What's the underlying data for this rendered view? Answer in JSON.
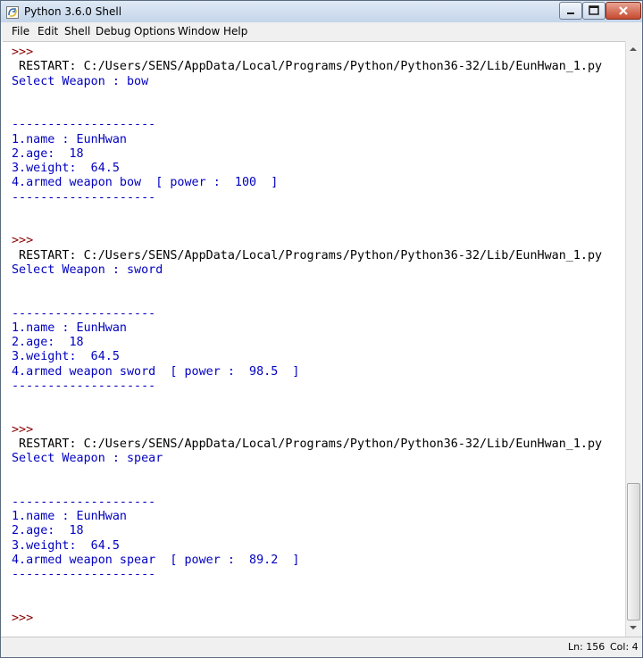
{
  "window": {
    "title": "Python 3.6.0 Shell"
  },
  "menu": [
    "File",
    "Edit",
    "Shell",
    "Debug",
    "Options",
    "Window",
    "Help"
  ],
  "shell_lines": [
    {
      "kind": "prompt",
      "text": ">>>"
    },
    {
      "kind": "restart",
      "text": " RESTART: C:/Users/SENS/AppData/Local/Programs/Python/Python36-32/Lib/EunHwan_1.py"
    },
    {
      "kind": "output",
      "text": "Select Weapon : bow"
    },
    {
      "kind": "output",
      "text": ""
    },
    {
      "kind": "output",
      "text": ""
    },
    {
      "kind": "output",
      "text": "--------------------"
    },
    {
      "kind": "output",
      "text": "1.name : EunHwan"
    },
    {
      "kind": "output",
      "text": "2.age:  18"
    },
    {
      "kind": "output",
      "text": "3.weight:  64.5"
    },
    {
      "kind": "output",
      "text": "4.armed weapon bow  [ power :  100  ]"
    },
    {
      "kind": "output",
      "text": "--------------------"
    },
    {
      "kind": "output",
      "text": ""
    },
    {
      "kind": "output",
      "text": ""
    },
    {
      "kind": "prompt",
      "text": ">>>"
    },
    {
      "kind": "restart",
      "text": " RESTART: C:/Users/SENS/AppData/Local/Programs/Python/Python36-32/Lib/EunHwan_1.py"
    },
    {
      "kind": "output",
      "text": "Select Weapon : sword"
    },
    {
      "kind": "output",
      "text": ""
    },
    {
      "kind": "output",
      "text": ""
    },
    {
      "kind": "output",
      "text": "--------------------"
    },
    {
      "kind": "output",
      "text": "1.name : EunHwan"
    },
    {
      "kind": "output",
      "text": "2.age:  18"
    },
    {
      "kind": "output",
      "text": "3.weight:  64.5"
    },
    {
      "kind": "output",
      "text": "4.armed weapon sword  [ power :  98.5  ]"
    },
    {
      "kind": "output",
      "text": "--------------------"
    },
    {
      "kind": "output",
      "text": ""
    },
    {
      "kind": "output",
      "text": ""
    },
    {
      "kind": "prompt",
      "text": ">>>"
    },
    {
      "kind": "restart",
      "text": " RESTART: C:/Users/SENS/AppData/Local/Programs/Python/Python36-32/Lib/EunHwan_1.py"
    },
    {
      "kind": "output",
      "text": "Select Weapon : spear"
    },
    {
      "kind": "output",
      "text": ""
    },
    {
      "kind": "output",
      "text": ""
    },
    {
      "kind": "output",
      "text": "--------------------"
    },
    {
      "kind": "output",
      "text": "1.name : EunHwan"
    },
    {
      "kind": "output",
      "text": "2.age:  18"
    },
    {
      "kind": "output",
      "text": "3.weight:  64.5"
    },
    {
      "kind": "output",
      "text": "4.armed weapon spear  [ power :  89.2  ]"
    },
    {
      "kind": "output",
      "text": "--------------------"
    },
    {
      "kind": "output",
      "text": ""
    },
    {
      "kind": "output",
      "text": ""
    },
    {
      "kind": "prompt",
      "text": ">>>"
    }
  ],
  "status": {
    "line": "Ln: 156",
    "col": "Col: 4"
  },
  "colors": {
    "prompt": "#8b0000",
    "output": "#0000c0",
    "restart": "#000000"
  },
  "icons": {
    "app": "python-idle-icon",
    "minimize": "minimize-icon",
    "maximize": "maximize-icon",
    "close": "close-icon"
  }
}
